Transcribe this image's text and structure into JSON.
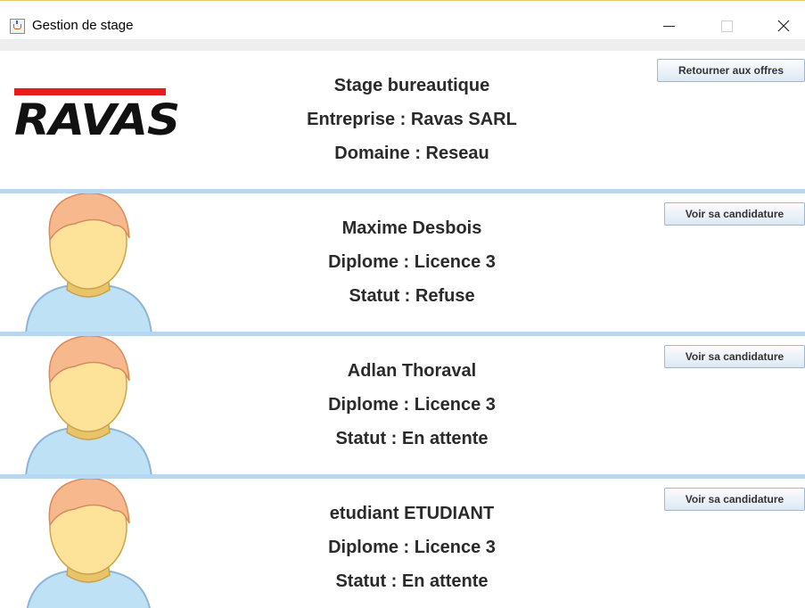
{
  "window": {
    "title": "Gestion de stage"
  },
  "offer": {
    "logo_text": "RAVAS",
    "title": "Stage bureautique",
    "company": "Entreprise : Ravas SARL",
    "domain": "Domaine : Reseau",
    "back_button": "Retourner aux offres"
  },
  "candidates": [
    {
      "name": "Maxime Desbois",
      "diploma": "Diplome : Licence 3",
      "status": "Statut : Refuse",
      "button": "Voir sa candidature"
    },
    {
      "name": "Adlan Thoraval",
      "diploma": "Diplome : Licence 3",
      "status": "Statut : En attente",
      "button": "Voir sa candidature"
    },
    {
      "name": "etudiant ETUDIANT",
      "diploma": "Diplome : Licence 3",
      "status": "Statut : En attente",
      "button": "Voir sa candidature"
    }
  ],
  "colors": {
    "separator": "#b8d7f3",
    "logo_red": "#e61d1d",
    "avatar_skin": "#fde29a",
    "avatar_hair": "#f8b88d",
    "avatar_shirt": "#bfe1f6"
  },
  "icons": {
    "app": "java-cup-icon",
    "avatar": "user-avatar-icon",
    "minimize": "minimize-icon",
    "maximize": "maximize-icon",
    "close": "close-icon"
  }
}
